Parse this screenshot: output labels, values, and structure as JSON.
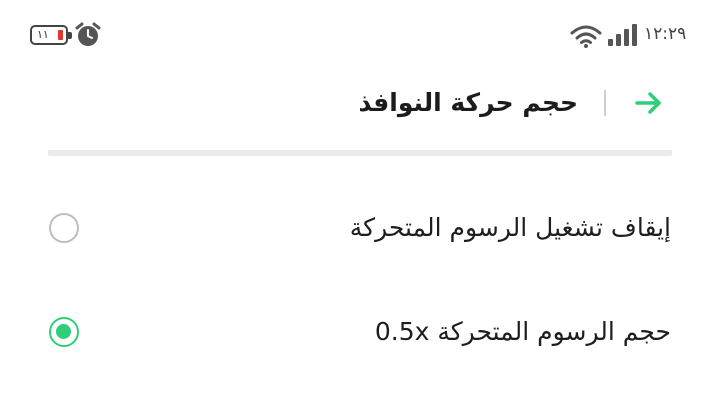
{
  "status_bar": {
    "battery_level": "١١",
    "time": "١٢:٢٩",
    "icons": [
      "battery-icon",
      "alarm-icon",
      "wifi-icon",
      "signal-icon"
    ]
  },
  "header": {
    "title": "حجم حركة النوافذ",
    "back_icon": "arrow-right-icon"
  },
  "options": [
    {
      "label": "إيقاف تشغيل الرسوم المتحركة",
      "selected": false
    },
    {
      "label": "حجم الرسوم المتحركة 0.5x",
      "selected": true
    }
  ],
  "colors": {
    "accent": "#2fcf7a",
    "battery_low": "#e0342c",
    "divider": "#ebebeb",
    "radio_off": "#bdbdbd"
  }
}
